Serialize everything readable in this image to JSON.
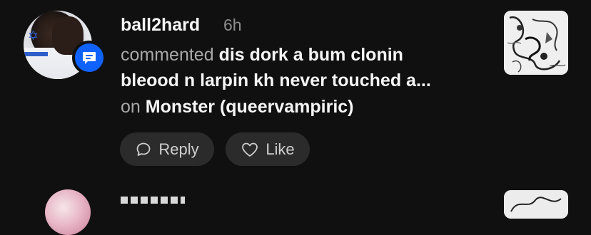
{
  "notification": {
    "username": "ball2hard",
    "time": "6h",
    "action": "commented",
    "comment_line1": "dis dork a bum clonin",
    "comment_line2": "bleood n larpin kh never touched a...",
    "on_label": "on",
    "post_title": "Monster (queervampiric)",
    "avatar": "user-avatar",
    "badge_icon": "comment-icon",
    "thumbnail": "post-thumbnail"
  },
  "actions": {
    "reply_label": "Reply",
    "like_label": "Like",
    "reply_icon": "reply-bubble-icon",
    "like_icon": "heart-icon"
  },
  "colors": {
    "background": "#101010",
    "badge": "#0f62fe",
    "button": "#2b2b2b",
    "muted_text": "#a8a8a8"
  }
}
